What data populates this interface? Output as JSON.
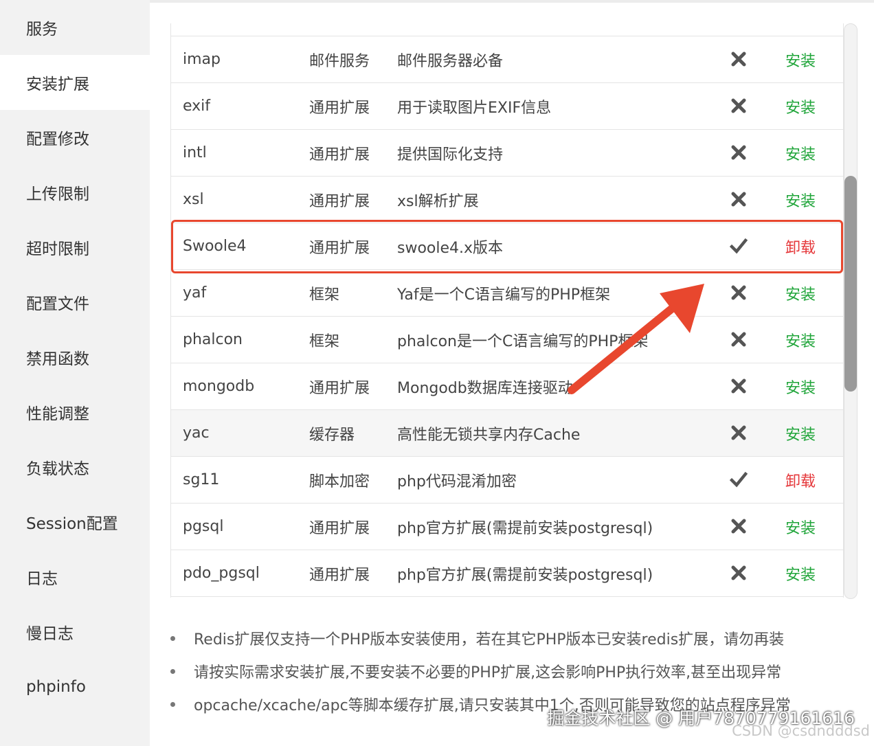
{
  "sidebar": {
    "items": [
      {
        "label": "服务"
      },
      {
        "label": "安装扩展"
      },
      {
        "label": "配置修改"
      },
      {
        "label": "上传限制"
      },
      {
        "label": "超时限制"
      },
      {
        "label": "配置文件"
      },
      {
        "label": "禁用函数"
      },
      {
        "label": "性能调整"
      },
      {
        "label": "负载状态"
      },
      {
        "label": "Session配置"
      },
      {
        "label": "日志"
      },
      {
        "label": "慢日志"
      },
      {
        "label": "phpinfo"
      }
    ],
    "active_index": 1
  },
  "extensions": {
    "rows": [
      {
        "name": "imap",
        "type": "邮件服务",
        "desc": "邮件服务器必备",
        "installed": false,
        "action": "安装"
      },
      {
        "name": "exif",
        "type": "通用扩展",
        "desc": "用于读取图片EXIF信息",
        "installed": false,
        "action": "安装"
      },
      {
        "name": "intl",
        "type": "通用扩展",
        "desc": "提供国际化支持",
        "installed": false,
        "action": "安装"
      },
      {
        "name": "xsl",
        "type": "通用扩展",
        "desc": "xsl解析扩展",
        "installed": false,
        "action": "安装"
      },
      {
        "name": "Swoole4",
        "type": "通用扩展",
        "desc": "swoole4.x版本",
        "installed": true,
        "action": "卸载"
      },
      {
        "name": "yaf",
        "type": "框架",
        "desc": "Yaf是一个C语言编写的PHP框架",
        "installed": false,
        "action": "安装"
      },
      {
        "name": "phalcon",
        "type": "框架",
        "desc": "phalcon是一个C语言编写的PHP框架",
        "installed": false,
        "action": "安装"
      },
      {
        "name": "mongodb",
        "type": "通用扩展",
        "desc": "Mongodb数据库连接驱动",
        "installed": false,
        "action": "安装"
      },
      {
        "name": "yac",
        "type": "缓存器",
        "desc": "高性能无锁共享内存Cache",
        "installed": false,
        "action": "安装"
      },
      {
        "name": "sg11",
        "type": "脚本加密",
        "desc": "php代码混淆加密",
        "installed": true,
        "action": "卸载"
      },
      {
        "name": "pgsql",
        "type": "通用扩展",
        "desc": "php官方扩展(需提前安装postgresql)",
        "installed": false,
        "action": "安装"
      },
      {
        "name": "pdo_pgsql",
        "type": "通用扩展",
        "desc": "php官方扩展(需提前安装postgresql)",
        "installed": false,
        "action": "安装"
      }
    ]
  },
  "tips": [
    "Redis扩展仅支持一个PHP版本安装使用，若在其它PHP版本已安装redis扩展，请勿再装",
    "请按实际需求安装扩展,不要安装不必要的PHP扩展,这会影响PHP执行效率,甚至出现异常",
    "opcache/xcache/apc等脚本缓存扩展,请只安装其中1个,否则可能导致您的站点程序异常"
  ],
  "watermark": {
    "line1": "掘金技术社区 @ 用户7870779161616",
    "line2": "CSDN @csdndddsd"
  },
  "colors": {
    "install": "#20a53a",
    "uninstall": "#e5383b",
    "highlight": "#e8472e"
  },
  "icons": {
    "installed": "check-icon",
    "not_installed": "cross-icon"
  }
}
